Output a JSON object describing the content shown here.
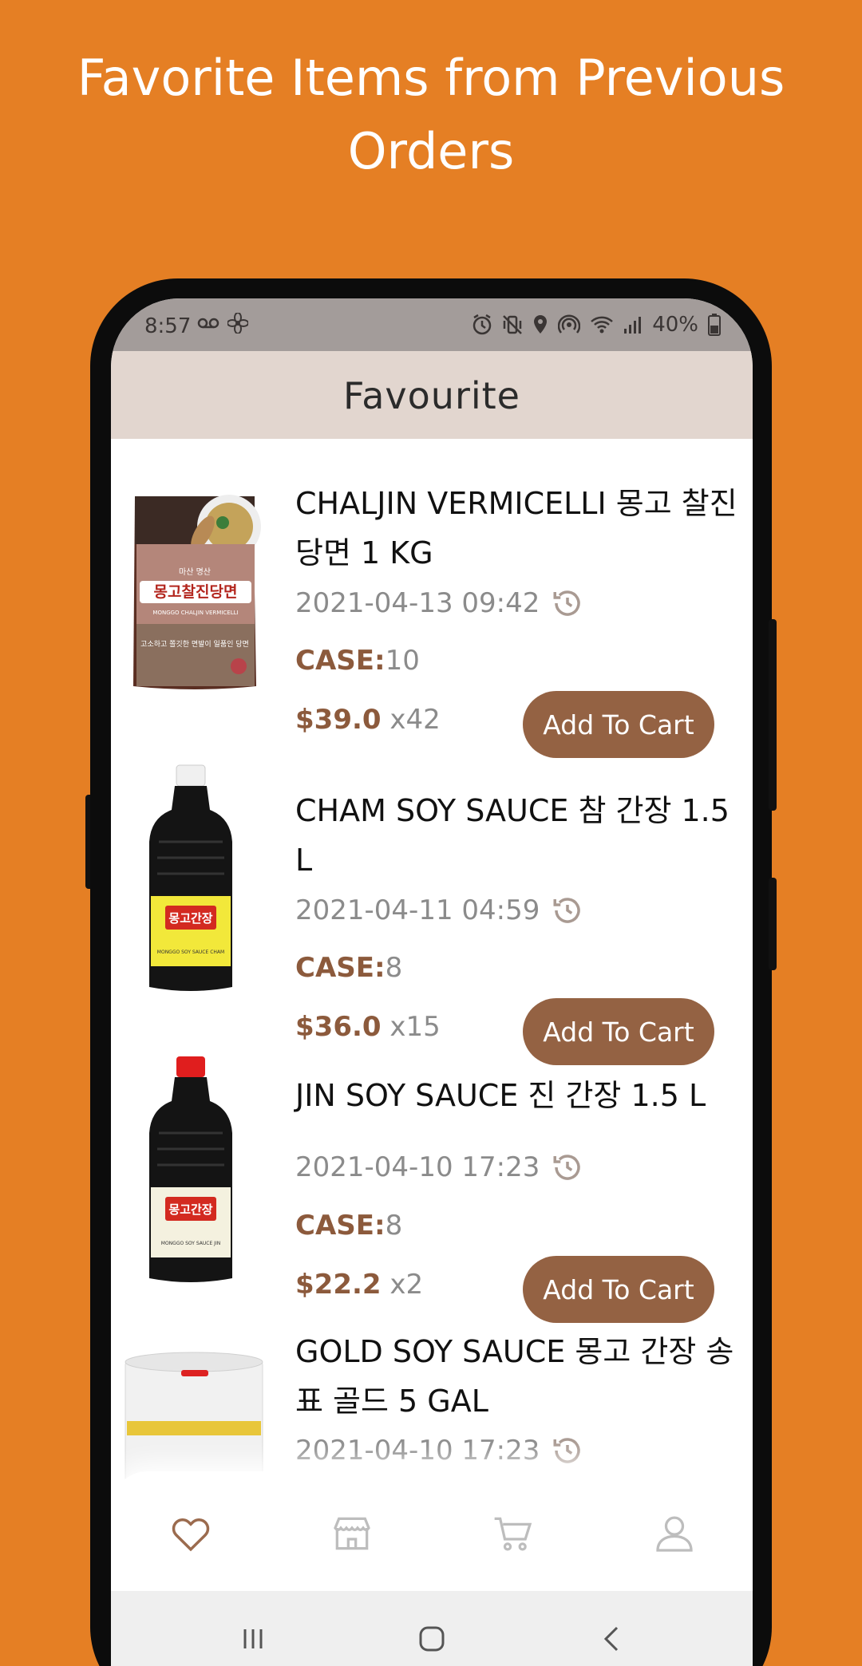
{
  "promo": {
    "title": "Favorite Items from Previous Orders"
  },
  "status_bar": {
    "time": "8:57",
    "battery": "40%"
  },
  "header": {
    "title": "Favourite"
  },
  "items": [
    {
      "name": "CHALJIN VERMICELLI 몽고 찰진 당면 1 KG",
      "date": "2021-04-13 09:42",
      "case_label": "CASE:",
      "case_value": "10",
      "price": "$39.0",
      "qty": "x42",
      "button": "Add To Cart"
    },
    {
      "name": "CHAM SOY SAUCE 참 간장 1.5 L",
      "date": "2021-04-11 04:59",
      "case_label": "CASE:",
      "case_value": "8",
      "price": "$36.0",
      "qty": "x15",
      "button": "Add To Cart"
    },
    {
      "name": "JIN SOY SAUCE 진 간장 1.5 L",
      "date": "2021-04-10 17:23",
      "case_label": "CASE:",
      "case_value": "8",
      "price": "$22.2",
      "qty": "x2",
      "button": "Add To Cart"
    },
    {
      "name": "GOLD SOY SAUCE 몽고 간장 송표 골드 5 GAL",
      "date": "2021-04-10 17:23"
    }
  ],
  "product_images": {
    "vermicelli": {
      "brand_line": "마산 명산",
      "title_text": "몽고찰진당면",
      "sub_text": "MONGGO CHALJIN VERMICELLI",
      "tagline": "고소하고 쫄깃한 면발이 일품인 당면"
    },
    "cham": {
      "label_text": "몽고간장",
      "sub_text": "MONGGO SOY SAUCE CHAM"
    },
    "jin": {
      "label_text": "몽고간장",
      "sub_text": "MONGGO SOY SAUCE JIN"
    }
  },
  "bottom_nav": [
    "heart-icon",
    "store-icon",
    "cart-icon",
    "profile-icon"
  ],
  "colors": {
    "background": "#E57F24",
    "accent": "#946243",
    "header": "#E2D6CF"
  }
}
